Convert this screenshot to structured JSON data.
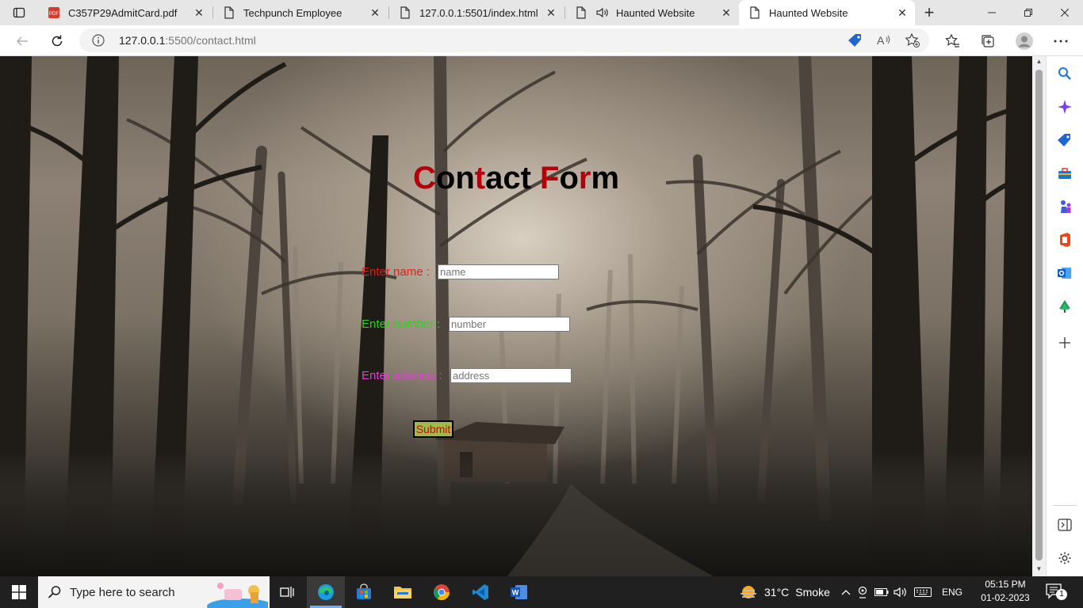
{
  "browser": {
    "tabs": [
      {
        "title": "C357P29AdmitCard.pdf",
        "icon": "pdf-icon"
      },
      {
        "title": "Techpunch Employee",
        "icon": "page-icon"
      },
      {
        "title": "127.0.0.1:5501/index.html",
        "icon": "page-icon"
      },
      {
        "title": "Haunted Website",
        "icon": "page-icon",
        "audio": true
      },
      {
        "title": "Haunted Website",
        "icon": "page-icon",
        "active": true
      }
    ],
    "address": {
      "host": "127.0.0.1",
      "rest": ":5500/contact.html"
    }
  },
  "page": {
    "title_parts": [
      "C",
      "on",
      "t",
      "act ",
      "F",
      "o",
      "r",
      "m"
    ],
    "fields": [
      {
        "label": "Enter name :",
        "placeholder": "name",
        "color": "#e0201a"
      },
      {
        "label": "Enter number :",
        "placeholder": "number",
        "color": "#2fd11f"
      },
      {
        "label": "Enter address :",
        "placeholder": "address",
        "color": "#e33fd3"
      }
    ],
    "submit_label": "Submit"
  },
  "taskbar": {
    "search_placeholder": "Type here to search",
    "weather": {
      "temp": "31°C",
      "condition": "Smoke"
    },
    "language": "ENG",
    "time": "05:15 PM",
    "date": "01-02-2023",
    "notification_count": "1"
  }
}
